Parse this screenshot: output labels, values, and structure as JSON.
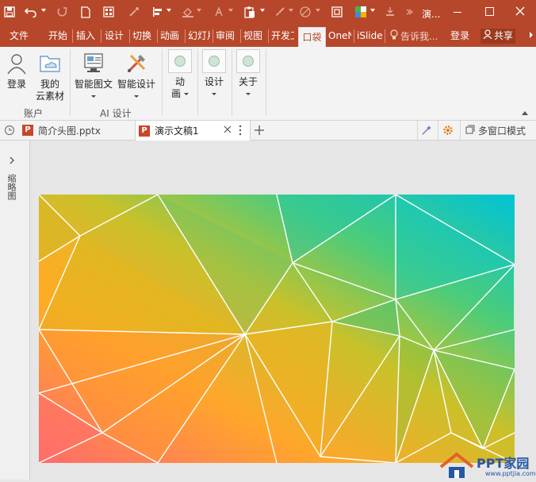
{
  "colors": {
    "title_bar": "#b7472a",
    "ribbon_bg": "#f3f3f3",
    "workspace_bg": "#e6e6e6",
    "accent": "#b7472a"
  },
  "titlebar": {
    "doc_title": "演...",
    "icons": [
      "save-icon",
      "undo-icon",
      "redo-icon",
      "new-doc-icon",
      "qr-icon",
      "eyedropper-icon",
      "align-icon",
      "fill-icon",
      "font-color-icon",
      "paste-icon",
      "brush-icon",
      "shape-icon",
      "crop-icon",
      "color-palette-icon",
      "layers-icon",
      "layers-more-icon"
    ]
  },
  "tabs": [
    {
      "label": "文件"
    },
    {
      "label": "开始"
    },
    {
      "label": "插入"
    },
    {
      "label": "设计"
    },
    {
      "label": "切换"
    },
    {
      "label": "动画"
    },
    {
      "label": "幻灯片"
    },
    {
      "label": "审阅"
    },
    {
      "label": "视图"
    },
    {
      "label": "开发工具"
    },
    {
      "label": "口袋"
    },
    {
      "label": "OneNote"
    },
    {
      "label": "iSlide"
    }
  ],
  "tell_me": "告诉我...",
  "login": "登录",
  "share": "共享",
  "ribbon": {
    "account_group": {
      "label": "账户",
      "login": "登录",
      "cloud_line1": "我的",
      "cloud_line2": "云素材"
    },
    "ai_group": {
      "label": "AI 设计",
      "smart_graphic": "智能图文",
      "smart_design": "智能设计"
    },
    "animate_line1": "动",
    "animate_line2": "画",
    "design": "设计",
    "about": "关于"
  },
  "doc_tabs": [
    {
      "title": "简介头图.pptx"
    },
    {
      "title": "演示文稿1"
    }
  ],
  "doc_tab_icon_letter": "P",
  "multi_window": "多窗口模式",
  "thumbnail_pane_label": "缩略图",
  "watermark": {
    "main": "PPT家园",
    "url": "www.pptjia.com"
  }
}
